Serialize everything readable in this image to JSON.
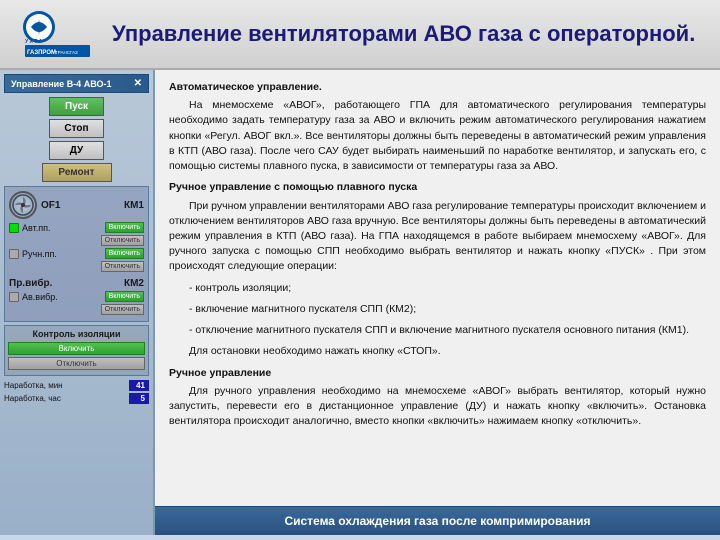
{
  "header": {
    "title": "Управление вентиляторами  АВО газа с операторной."
  },
  "panel": {
    "title": "Управление В-4 АВО-1",
    "buttons": {
      "pusk": "Пуск",
      "stop": "Стоп",
      "du": "ДУ",
      "remont": "Ремонт",
      "km1": "КМ1",
      "km2": "КМ2"
    },
    "of1_label": "ОF1",
    "avt_label": "Авт.пп.",
    "ruch_label": "Ручн.пп.",
    "pr_vibr": "Пр.вибр.",
    "av_vibr": "Ав.вибр.",
    "btn_on": "Включить",
    "btn_off": "Отключить",
    "isolation_title": "Контроль изоляции",
    "narab_min": "Наработка, мин",
    "narab_chas": "Наработка, час",
    "narab_min_val": "41",
    "narab_chas_val": "5"
  },
  "content": {
    "section1_title": "Автоматическое управление.",
    "section1_text": "На мнемосхеме «АВОГ», работающего ГПА для автоматического регулирования температуры необходимо задать температуру газа за АВО и включить режим автоматического регулирования нажатием кнопки «Регул. АВОГ вкл.». Все вентиляторы должны быть переведены в автоматический режим управления в КТП (АВО газа). После чего САУ будет выбирать наименьший по наработке вентилятор, и запускать его, с помощью системы плавного пуска, в зависимости от температуры газа за АВО.",
    "section2_title": "Ручное управление с помощью плавного пуска",
    "section2_text": "При ручном управлении вентиляторами АВО газа регулирование температуры происходит включением и отключением вентиляторов АВО газа вручную. Все вентиляторы должны быть переведены в автоматический режим управления в КТП (АВО газа). На ГПА находящемся в работе выбираем мнемосхему «АВОГ». Для ручного запуска с помощью СПП необходимо выбрать вентилятор и нажать кнопку «ПУСК» . При этом происходят следующие операции:",
    "list1": "- контроль изоляции;",
    "list2": "- включение магнитного пускателя СПП (КМ2);",
    "list3": "- отключение магнитного пускателя СПП и включение магнитного пускателя основного питания (КМ1).",
    "stop_note": "Для остановки необходимо нажать кнопку «СТОП».",
    "section3_title": "Ручное управление",
    "section3_text": "Для ручного управления необходимо на мнемосхеме «АВОГ» выбрать вентилятор, который нужно запустить, перевести его в дистанционное управление (ДУ) и нажать кнопку «включить». Остановка вентилятора происходит аналогично, вместо кнопки «включить» нажимаем кнопку «отключить»."
  },
  "footer": {
    "text": "Система охлаждения газа после компримирования"
  }
}
